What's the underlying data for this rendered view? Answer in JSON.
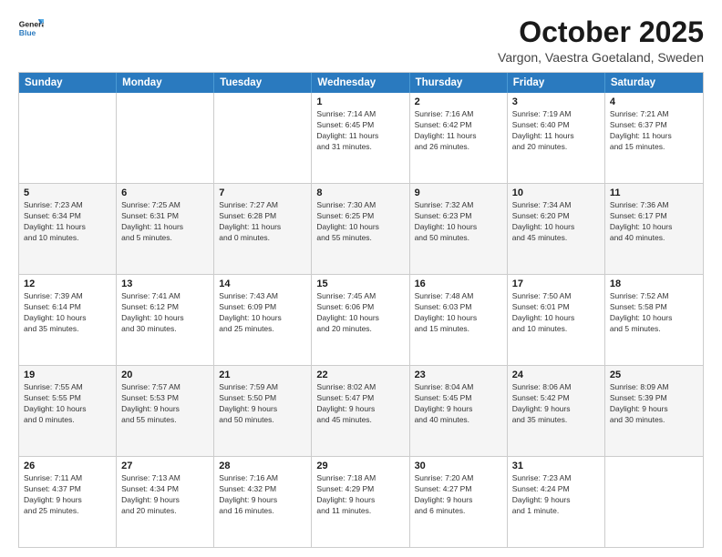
{
  "header": {
    "logo_line1": "General",
    "logo_line2": "Blue",
    "title": "October 2025",
    "subtitle": "Vargon, Vaestra Goetaland, Sweden"
  },
  "calendar": {
    "days_of_week": [
      "Sunday",
      "Monday",
      "Tuesday",
      "Wednesday",
      "Thursday",
      "Friday",
      "Saturday"
    ],
    "rows": [
      [
        {
          "day": "",
          "text": ""
        },
        {
          "day": "",
          "text": ""
        },
        {
          "day": "",
          "text": ""
        },
        {
          "day": "1",
          "text": "Sunrise: 7:14 AM\nSunset: 6:45 PM\nDaylight: 11 hours\nand 31 minutes."
        },
        {
          "day": "2",
          "text": "Sunrise: 7:16 AM\nSunset: 6:42 PM\nDaylight: 11 hours\nand 26 minutes."
        },
        {
          "day": "3",
          "text": "Sunrise: 7:19 AM\nSunset: 6:40 PM\nDaylight: 11 hours\nand 20 minutes."
        },
        {
          "day": "4",
          "text": "Sunrise: 7:21 AM\nSunset: 6:37 PM\nDaylight: 11 hours\nand 15 minutes."
        }
      ],
      [
        {
          "day": "5",
          "text": "Sunrise: 7:23 AM\nSunset: 6:34 PM\nDaylight: 11 hours\nand 10 minutes."
        },
        {
          "day": "6",
          "text": "Sunrise: 7:25 AM\nSunset: 6:31 PM\nDaylight: 11 hours\nand 5 minutes."
        },
        {
          "day": "7",
          "text": "Sunrise: 7:27 AM\nSunset: 6:28 PM\nDaylight: 11 hours\nand 0 minutes."
        },
        {
          "day": "8",
          "text": "Sunrise: 7:30 AM\nSunset: 6:25 PM\nDaylight: 10 hours\nand 55 minutes."
        },
        {
          "day": "9",
          "text": "Sunrise: 7:32 AM\nSunset: 6:23 PM\nDaylight: 10 hours\nand 50 minutes."
        },
        {
          "day": "10",
          "text": "Sunrise: 7:34 AM\nSunset: 6:20 PM\nDaylight: 10 hours\nand 45 minutes."
        },
        {
          "day": "11",
          "text": "Sunrise: 7:36 AM\nSunset: 6:17 PM\nDaylight: 10 hours\nand 40 minutes."
        }
      ],
      [
        {
          "day": "12",
          "text": "Sunrise: 7:39 AM\nSunset: 6:14 PM\nDaylight: 10 hours\nand 35 minutes."
        },
        {
          "day": "13",
          "text": "Sunrise: 7:41 AM\nSunset: 6:12 PM\nDaylight: 10 hours\nand 30 minutes."
        },
        {
          "day": "14",
          "text": "Sunrise: 7:43 AM\nSunset: 6:09 PM\nDaylight: 10 hours\nand 25 minutes."
        },
        {
          "day": "15",
          "text": "Sunrise: 7:45 AM\nSunset: 6:06 PM\nDaylight: 10 hours\nand 20 minutes."
        },
        {
          "day": "16",
          "text": "Sunrise: 7:48 AM\nSunset: 6:03 PM\nDaylight: 10 hours\nand 15 minutes."
        },
        {
          "day": "17",
          "text": "Sunrise: 7:50 AM\nSunset: 6:01 PM\nDaylight: 10 hours\nand 10 minutes."
        },
        {
          "day": "18",
          "text": "Sunrise: 7:52 AM\nSunset: 5:58 PM\nDaylight: 10 hours\nand 5 minutes."
        }
      ],
      [
        {
          "day": "19",
          "text": "Sunrise: 7:55 AM\nSunset: 5:55 PM\nDaylight: 10 hours\nand 0 minutes."
        },
        {
          "day": "20",
          "text": "Sunrise: 7:57 AM\nSunset: 5:53 PM\nDaylight: 9 hours\nand 55 minutes."
        },
        {
          "day": "21",
          "text": "Sunrise: 7:59 AM\nSunset: 5:50 PM\nDaylight: 9 hours\nand 50 minutes."
        },
        {
          "day": "22",
          "text": "Sunrise: 8:02 AM\nSunset: 5:47 PM\nDaylight: 9 hours\nand 45 minutes."
        },
        {
          "day": "23",
          "text": "Sunrise: 8:04 AM\nSunset: 5:45 PM\nDaylight: 9 hours\nand 40 minutes."
        },
        {
          "day": "24",
          "text": "Sunrise: 8:06 AM\nSunset: 5:42 PM\nDaylight: 9 hours\nand 35 minutes."
        },
        {
          "day": "25",
          "text": "Sunrise: 8:09 AM\nSunset: 5:39 PM\nDaylight: 9 hours\nand 30 minutes."
        }
      ],
      [
        {
          "day": "26",
          "text": "Sunrise: 7:11 AM\nSunset: 4:37 PM\nDaylight: 9 hours\nand 25 minutes."
        },
        {
          "day": "27",
          "text": "Sunrise: 7:13 AM\nSunset: 4:34 PM\nDaylight: 9 hours\nand 20 minutes."
        },
        {
          "day": "28",
          "text": "Sunrise: 7:16 AM\nSunset: 4:32 PM\nDaylight: 9 hours\nand 16 minutes."
        },
        {
          "day": "29",
          "text": "Sunrise: 7:18 AM\nSunset: 4:29 PM\nDaylight: 9 hours\nand 11 minutes."
        },
        {
          "day": "30",
          "text": "Sunrise: 7:20 AM\nSunset: 4:27 PM\nDaylight: 9 hours\nand 6 minutes."
        },
        {
          "day": "31",
          "text": "Sunrise: 7:23 AM\nSunset: 4:24 PM\nDaylight: 9 hours\nand 1 minute."
        },
        {
          "day": "",
          "text": ""
        }
      ]
    ]
  }
}
